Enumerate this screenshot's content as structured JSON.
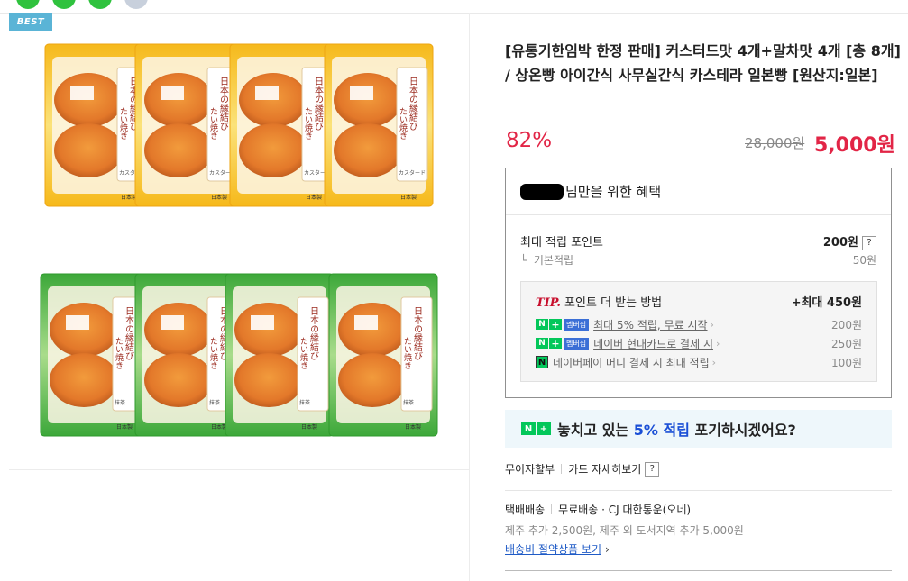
{
  "badge": "BEST",
  "product": {
    "title": "[유통기한임박 한정 판매] 커스터드맛 4개+말차맛 4개 [총 8개] / 상온빵 아이간식 사무실간식 카스테라 일본빵 [원산지:일본]",
    "discount": "82%",
    "original_price": "28,000원",
    "sale_price": "5,000원"
  },
  "package": {
    "text_main": "日本の縁結び",
    "text_sub": "たい焼き",
    "custard_label": "カスタード",
    "matcha_label": "抹茶",
    "origin_label": "日本製"
  },
  "benefit": {
    "header": "님만을 위한 혜택",
    "max_points_label": "최대 적립 포인트",
    "max_points_value": "200원",
    "help": "?",
    "base_label": "기본적립",
    "base_value": "50원",
    "tip": {
      "tip_word": "TIP.",
      "title": "포인트 더 받는 방법",
      "max": "+최대 450원",
      "items": [
        {
          "text": "최대 5% 적립, 무료 시작",
          "value": "200원",
          "badge": "멤버십"
        },
        {
          "text": "네이버 현대카드로 결제 시",
          "value": "250원",
          "badge": "멤버십"
        },
        {
          "text": "네이버페이 머니 결제 시 최대 적립",
          "value": "100원"
        }
      ]
    }
  },
  "banner": {
    "n_badge": "N",
    "plus": "+",
    "text_before": "놓치고 있는 ",
    "highlight": "5% 적립",
    "text_after": " 포기하시겠어요?"
  },
  "payment": {
    "interest_free": "무이자할부",
    "card_detail": "카드 자세히보기",
    "help": "?"
  },
  "shipping": {
    "type": "택배배송",
    "info": "무료배송 · CJ 대한통운(오네)",
    "extra": "제주 추가 2,500원, 제주 외 도서지역 추가 5,000원",
    "link": "배송비 절약상품 보기",
    "chevron": "›"
  },
  "colors": {
    "accent_red": "#e22546",
    "naver_green": "#03c75a",
    "link_blue": "#1f5bc6",
    "custard_bg": "#f7c83a",
    "matcha_bg": "#52b848"
  }
}
